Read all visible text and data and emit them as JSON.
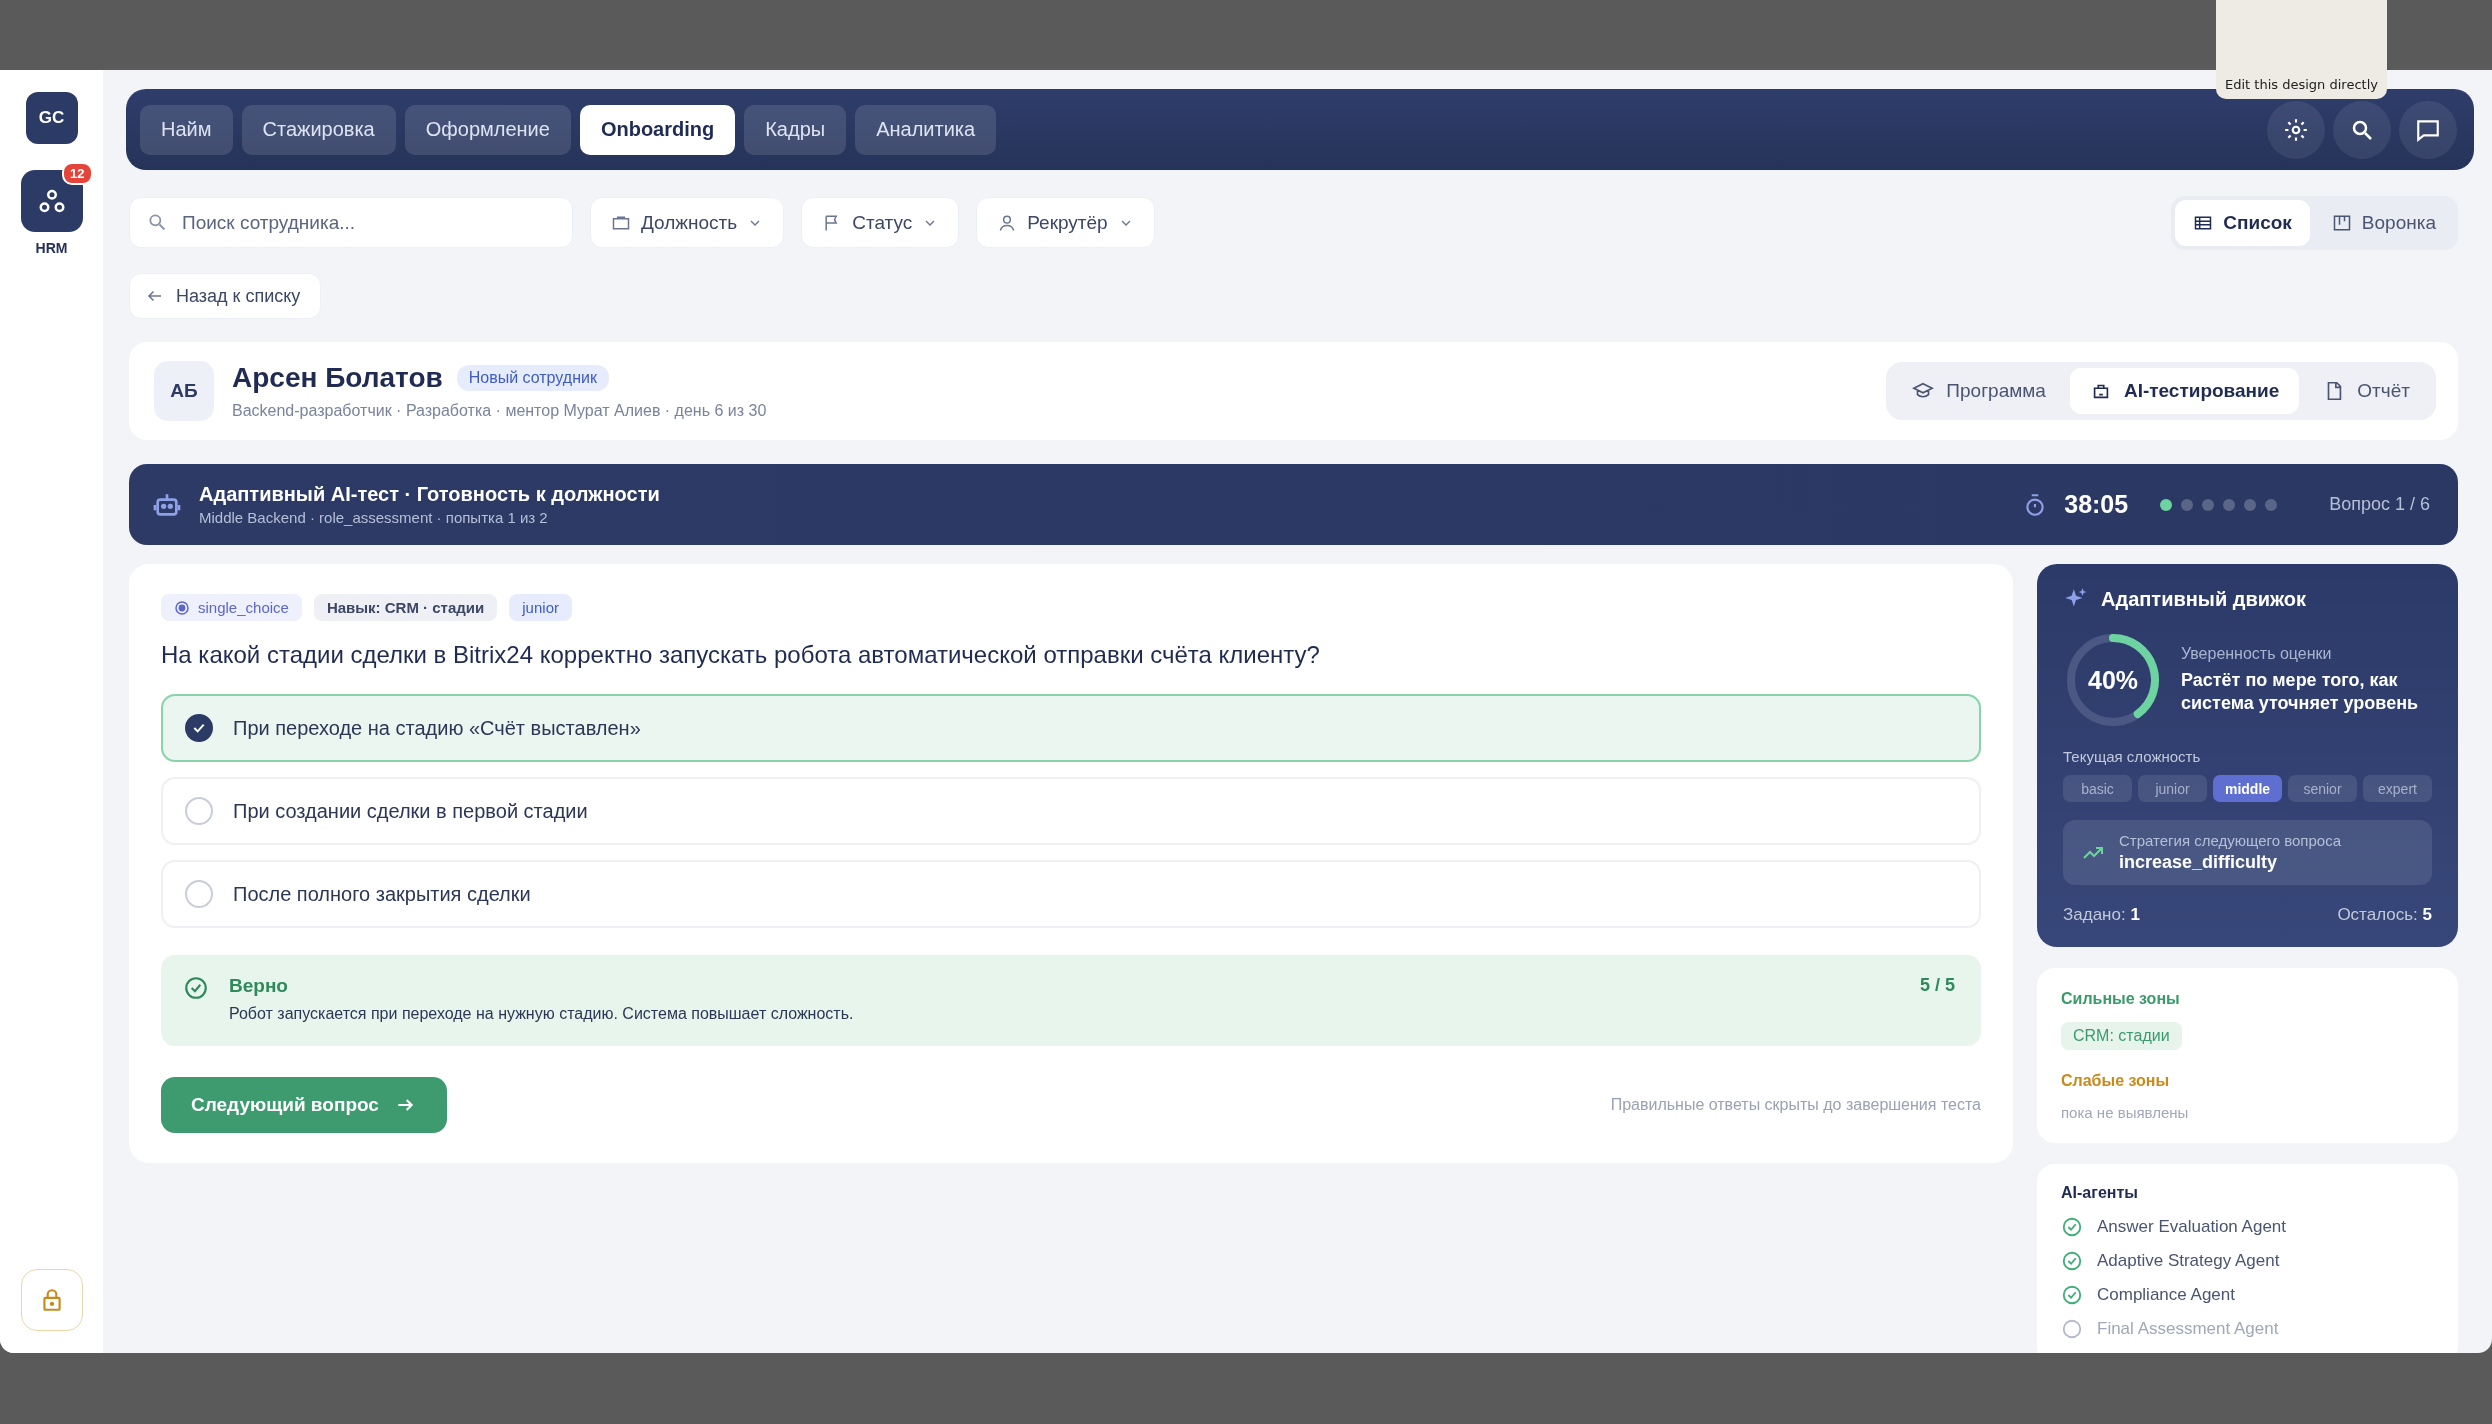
{
  "tooltip": {
    "text": "Edit this design directly"
  },
  "sidebar": {
    "avatar": "GC",
    "apps": [
      {
        "label": "HRM",
        "badge": "12",
        "selected": true
      }
    ]
  },
  "nav": {
    "tabs": [
      {
        "label": "Найм",
        "selected": false
      },
      {
        "label": "Стажировка",
        "selected": false
      },
      {
        "label": "Оформление",
        "selected": false
      },
      {
        "label": "Onboarding",
        "selected": true
      },
      {
        "label": "Кадры",
        "selected": false
      },
      {
        "label": "Аналитика",
        "selected": false
      }
    ]
  },
  "filters": {
    "search": {
      "placeholder": "Поиск сотрудника..."
    },
    "dropdowns": [
      {
        "label": "Должность"
      },
      {
        "label": "Статус"
      },
      {
        "label": "Рекрутёр"
      }
    ]
  },
  "view_toggle": [
    {
      "label": "Список",
      "selected": true
    },
    {
      "label": "Воронка",
      "selected": false
    }
  ],
  "back_button": "Назад к списку",
  "employee": {
    "initials": "АБ",
    "name": "Арсен Болатов",
    "badge": "Новый сотрудник",
    "meta": "Backend-разработчик · Разработка · ментор Мурат Алиев · день 6 из 30"
  },
  "employee_tabs": [
    {
      "label": "Программа",
      "selected": false
    },
    {
      "label": "AI-тестирование",
      "selected": true
    },
    {
      "label": "Отчёт",
      "selected": false
    }
  ],
  "test_banner": {
    "title": "Адаптивный AI-тест · Готовность к должности",
    "subtitle": "Middle Backend · role_assessment · попытка 1 из 2",
    "timer": "38:05",
    "progress_dots": [
      {
        "done": true
      },
      {
        "done": false
      },
      {
        "done": false
      },
      {
        "done": false
      },
      {
        "done": false
      },
      {
        "done": false
      }
    ],
    "counter": "Вопрос 1 / 6"
  },
  "question": {
    "tags": [
      {
        "label": "single_choice",
        "kind": "type"
      },
      {
        "label": "Навык: CRM · стадии",
        "kind": "skill"
      },
      {
        "label": "junior",
        "kind": "level"
      }
    ],
    "text": "На какой стадии сделки в Bitrix24 корректно запускать робота автоматической отправки счёта клиенту?",
    "options": [
      {
        "label": "При переходе на стадию «Счёт выставлен»",
        "selected": true
      },
      {
        "label": "При создании сделки в первой стадии",
        "selected": false
      },
      {
        "label": "После полного закрытия сделки",
        "selected": false
      }
    ],
    "feedback": {
      "correct": true,
      "title": "Верно",
      "text": "Робот запускается при переходе на нужную стадию. Система повышает сложность.",
      "score": "5 / 5"
    },
    "next_button": "Следующий вопрос",
    "note": "Правильные ответы скрыты до завершения теста"
  },
  "engine": {
    "title": "Адаптивный движок",
    "confidence": {
      "value": "40%",
      "label": "Уверенность оценки",
      "description": "Растёт по мере того, как система уточняет уровень"
    },
    "difficulty_label": "Текущая сложность",
    "difficulties": [
      {
        "label": "basic",
        "selected": false
      },
      {
        "label": "junior",
        "selected": false
      },
      {
        "label": "middle",
        "selected": true
      },
      {
        "label": "senior",
        "selected": false
      },
      {
        "label": "expert",
        "selected": false
      }
    ],
    "strategy": {
      "label": "Стратегия следующего вопроса",
      "value": "increase_difficulty"
    },
    "asked": "Задано: **1**",
    "remaining": "Осталось: **5**"
  },
  "zones": {
    "strong_title": "Сильные зоны",
    "strong": [
      "CRM: стадии"
    ],
    "weak_title": "Слабые зоны",
    "weak_empty": "пока не выявлены"
  },
  "agents": {
    "title": "AI-агенты",
    "items": [
      {
        "name": "Answer Evaluation Agent",
        "done": true
      },
      {
        "name": "Adaptive Strategy Agent",
        "done": true
      },
      {
        "name": "Compliance Agent",
        "done": true
      },
      {
        "name": "Final Assessment Agent",
        "done": false
      }
    ]
  }
}
